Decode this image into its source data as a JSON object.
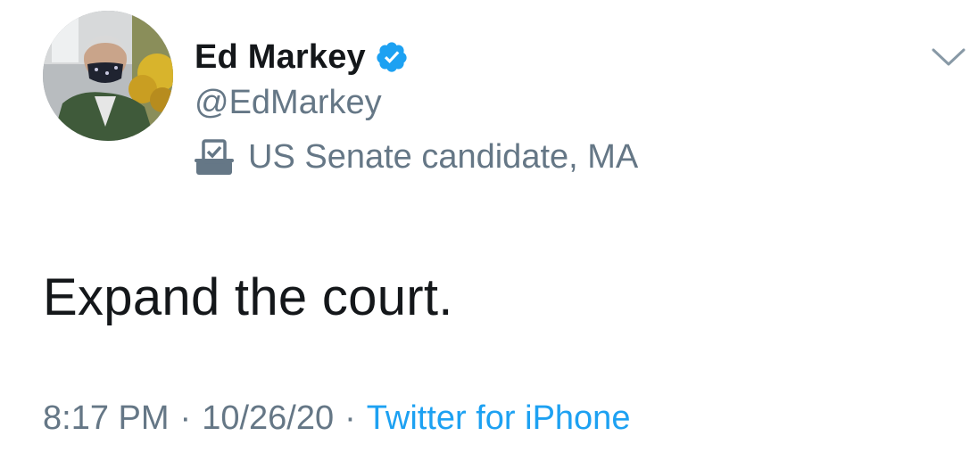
{
  "author": {
    "display_name": "Ed Markey",
    "handle": "@EdMarkey",
    "verified_icon": "verified-badge-icon",
    "label": "US Senate candidate, MA",
    "label_icon": "ballot-box-icon"
  },
  "tweet": {
    "text": "Expand the court.",
    "time": "8:17 PM",
    "separator": "·",
    "date": "10/26/20",
    "source": "Twitter for iPhone"
  },
  "colors": {
    "primary_text": "#14171a",
    "secondary_text": "#657786",
    "link": "#1da1f2",
    "verified": "#1da1f2"
  },
  "menu_icon": "chevron-down-icon"
}
